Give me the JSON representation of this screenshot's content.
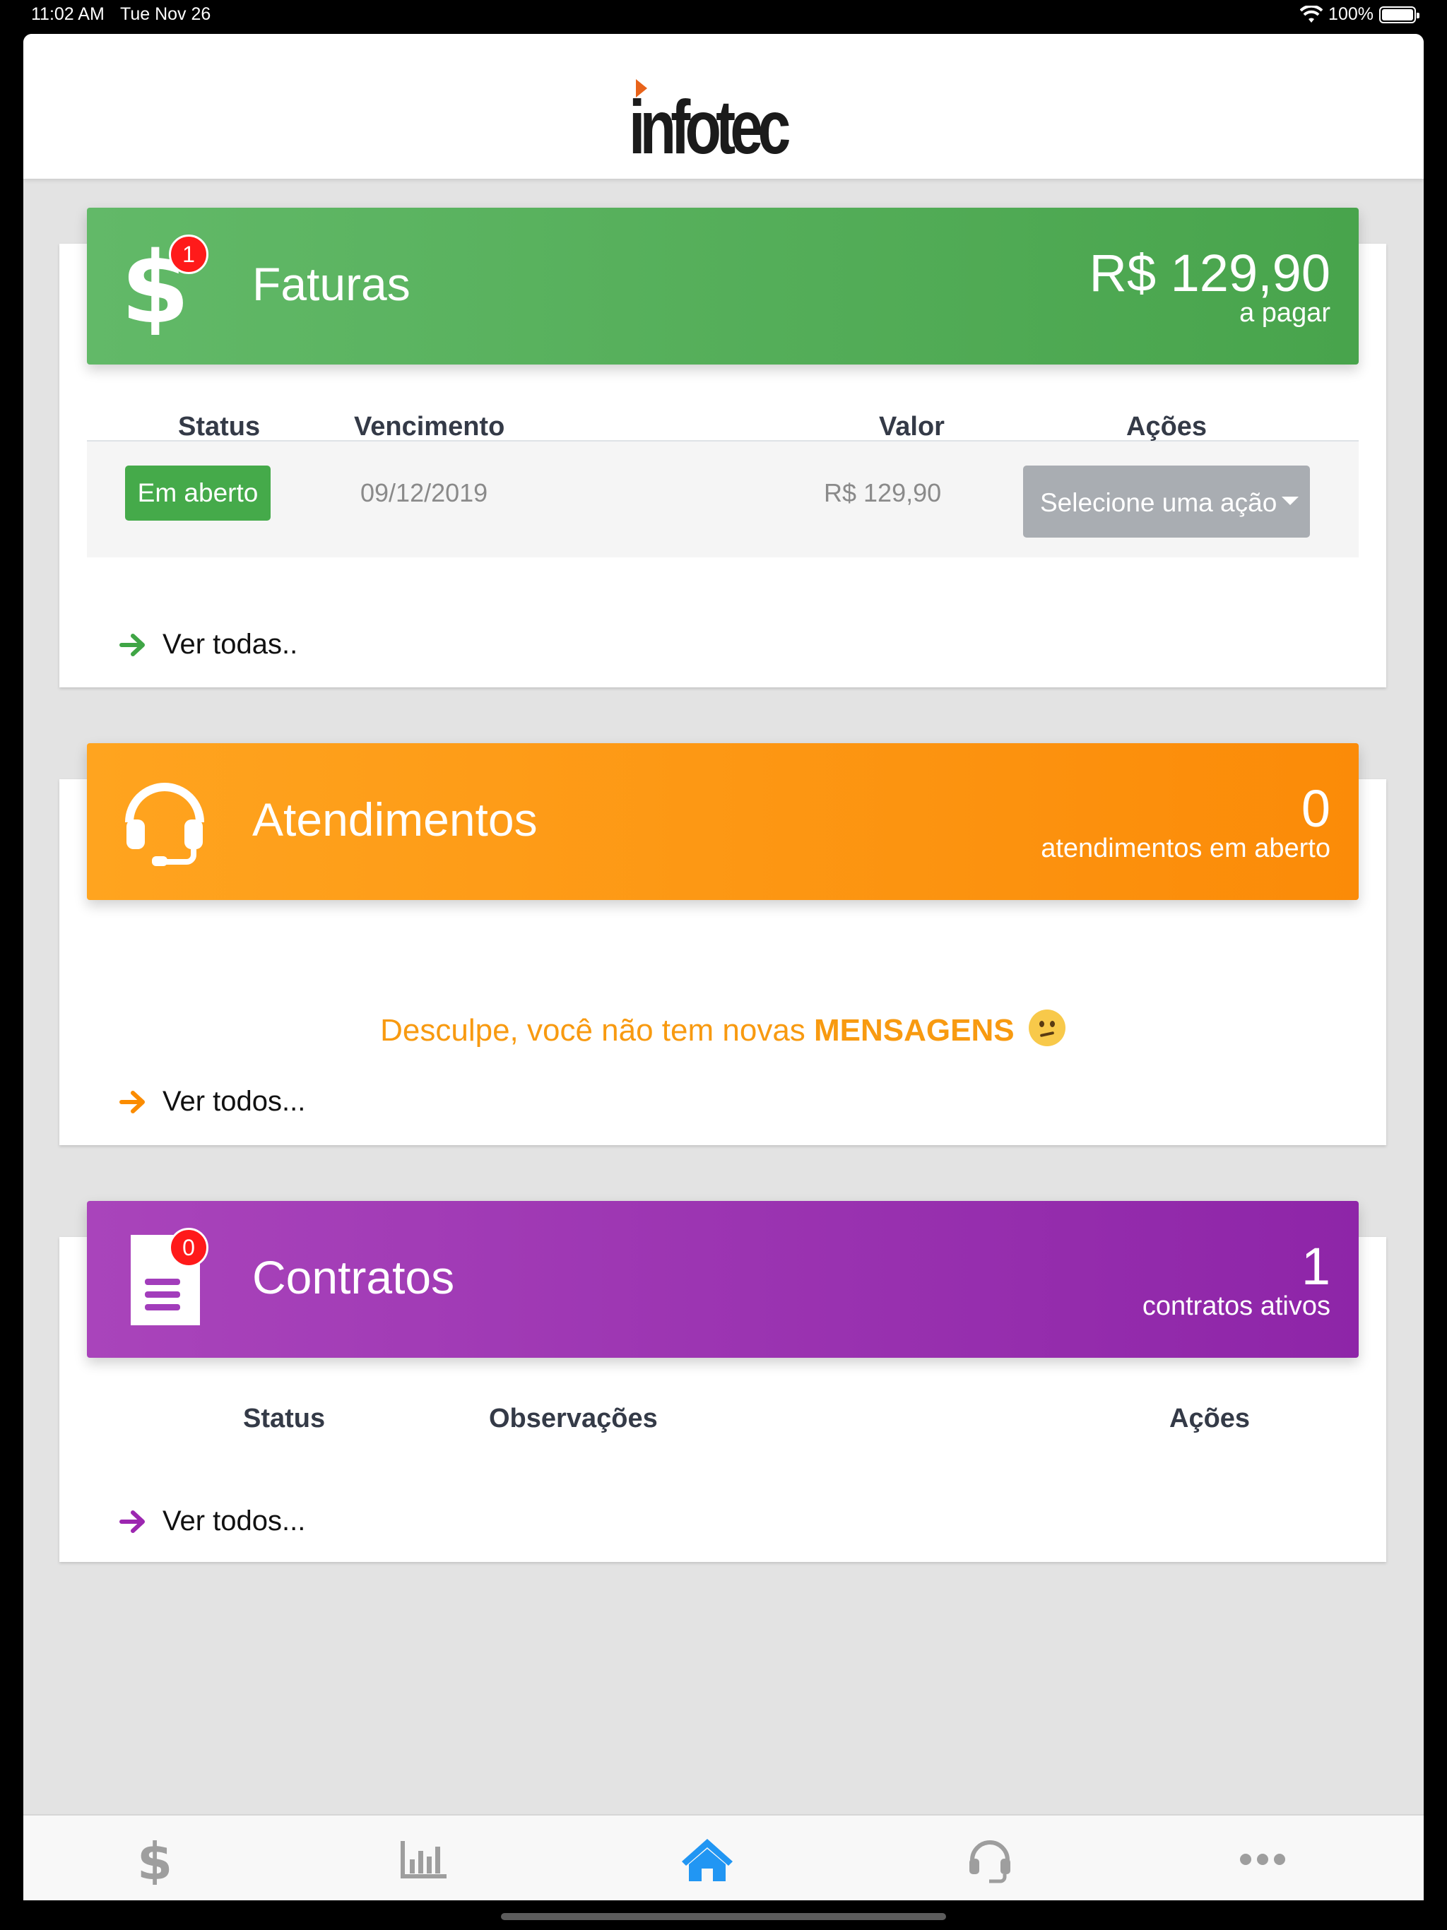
{
  "status_bar": {
    "time": "11:02 AM",
    "date": "Tue Nov 26",
    "battery": "100%"
  },
  "header": {
    "logo_text": "infotec"
  },
  "faturas": {
    "title": "Faturas",
    "badge": "1",
    "amount": "R$ 129,90",
    "amount_label": "a pagar",
    "table": {
      "headers": {
        "status": "Status",
        "due": "Vencimento",
        "value": "Valor",
        "actions": "Ações"
      },
      "rows": [
        {
          "status": "Em aberto",
          "due": "09/12/2019",
          "value": "R$ 129,90",
          "action_placeholder": "Selecione uma ação"
        }
      ]
    },
    "see_all": "Ver todas.."
  },
  "atendimentos": {
    "title": "Atendimentos",
    "count": "0",
    "count_label": "atendimentos em aberto",
    "message_prefix": "Desculpe, você não tem novas",
    "message_highlight": "MENSAGENS",
    "see_all": "Ver todos..."
  },
  "contratos": {
    "title": "Contratos",
    "badge": "0",
    "count": "1",
    "count_label": "contratos ativos",
    "table": {
      "headers": {
        "status": "Status",
        "notes": "Observações",
        "actions": "Ações"
      }
    },
    "see_all": "Ver todos..."
  },
  "tabbar": {
    "items": [
      {
        "icon": "dollar-icon",
        "active": false
      },
      {
        "icon": "bar-chart-icon",
        "active": false
      },
      {
        "icon": "home-icon",
        "active": true
      },
      {
        "icon": "headset-icon",
        "active": false
      },
      {
        "icon": "more-icon",
        "active": false
      }
    ]
  },
  "colors": {
    "green": "#4caf50",
    "orange": "#fb8c00",
    "purple": "#9c27b0",
    "tab_active": "#2196f3",
    "tab_inactive": "#9e9e9e"
  }
}
